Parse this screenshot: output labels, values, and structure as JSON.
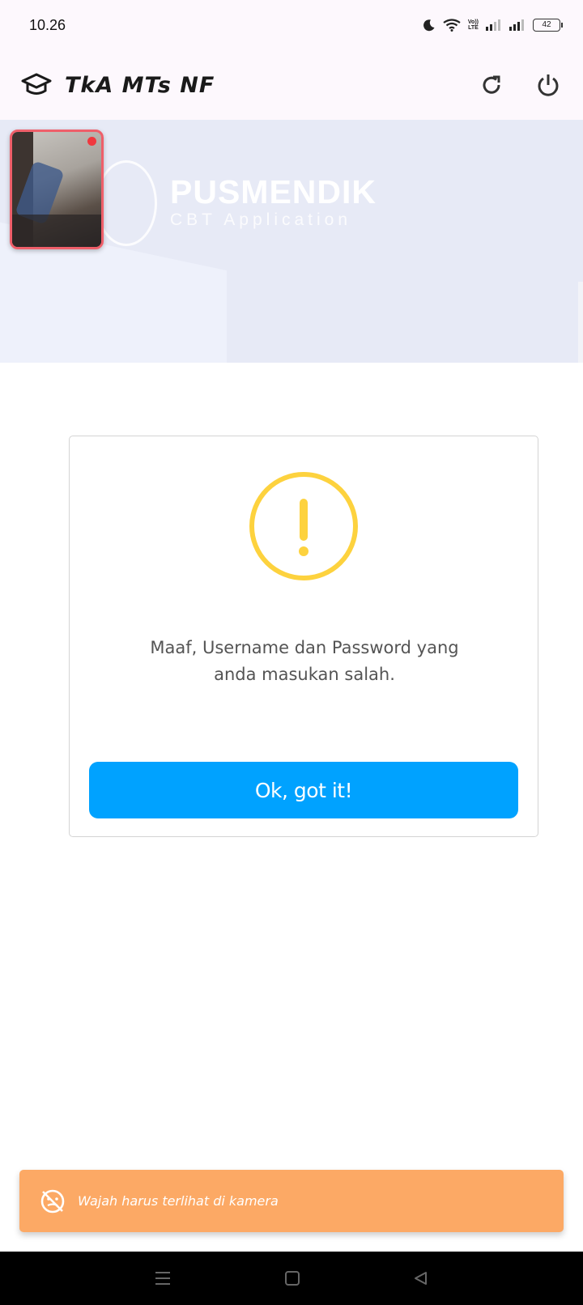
{
  "status_bar": {
    "time": "10.26",
    "volte_line1": "Vo))",
    "volte_line2": "LTE",
    "battery": "42"
  },
  "app_bar": {
    "title": "TkA MTs NF",
    "icons": [
      "graduation-cap-icon",
      "refresh-icon",
      "power-icon"
    ]
  },
  "banner": {
    "brand": "PUSMENDIK",
    "subtitle": "CBT Application"
  },
  "dialog": {
    "icon": "warning-icon",
    "accent_color": "#fdd23e",
    "message_line1": "Maaf, Username dan Password yang",
    "message_line2": "anda masukan salah.",
    "button_label": "Ok, got it!",
    "button_color": "#00a2ff"
  },
  "toast": {
    "icon": "face-hidden-icon",
    "text": "Wajah harus terlihat di kamera",
    "color": "#fca965"
  },
  "nav_bar": {
    "icons": [
      "recents-icon",
      "home-icon",
      "back-icon"
    ]
  }
}
